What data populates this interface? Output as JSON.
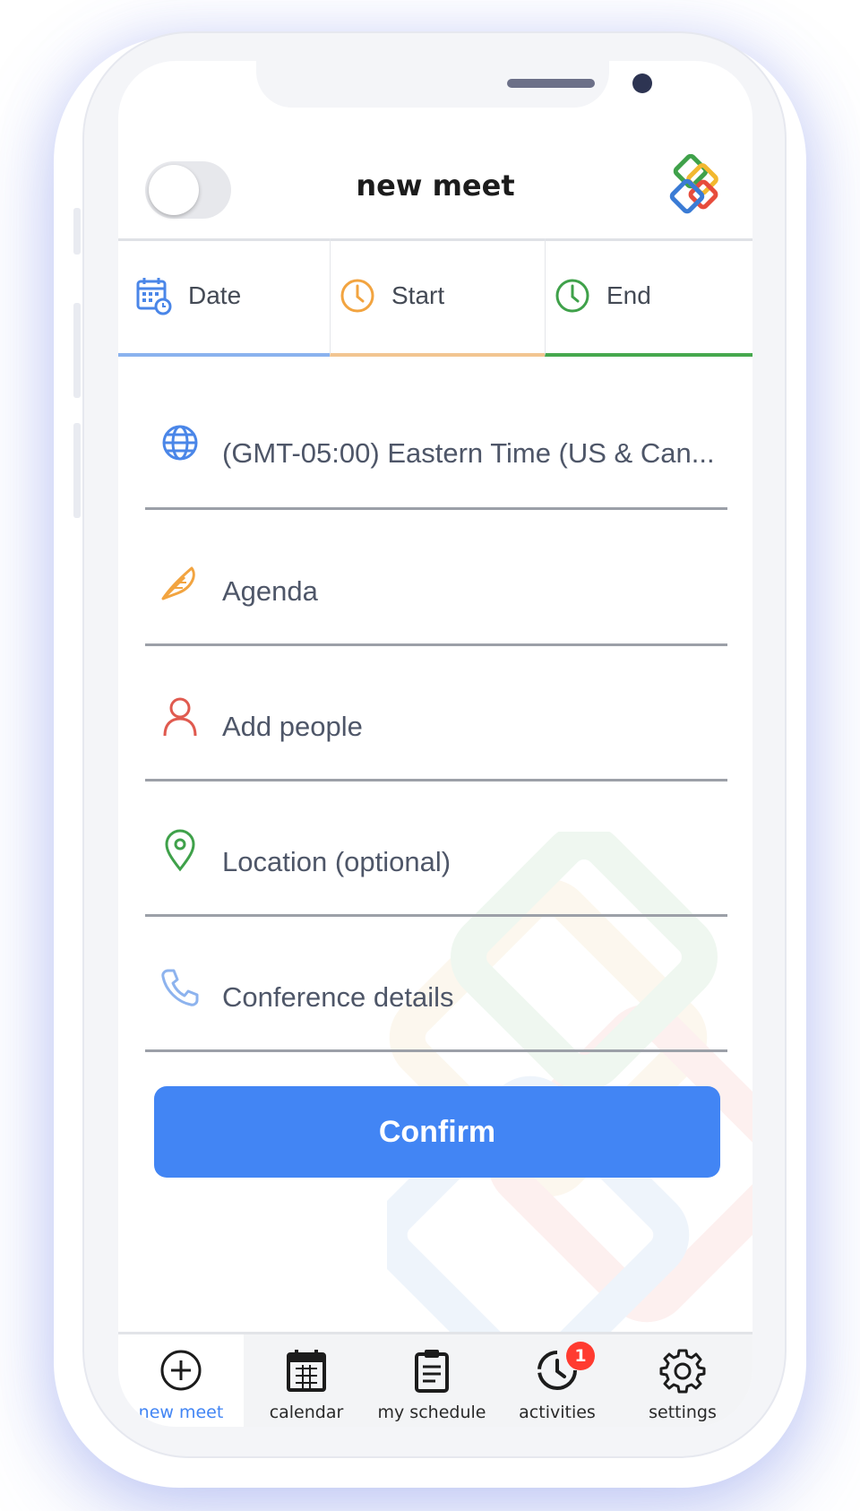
{
  "app": {
    "title": "new meet",
    "colors": {
      "accent": "#4285f4",
      "date_tab": "#8ab2ee",
      "start_tab": "#f2c591",
      "end_tab": "#46a84e",
      "badge": "#ff3b30"
    }
  },
  "header": {
    "toggle_state": "off",
    "logo_icon": "app-logo-icon"
  },
  "tabs": [
    {
      "label": "Date",
      "icon": "calendar-clock-icon"
    },
    {
      "label": "Start",
      "icon": "clock-icon"
    },
    {
      "label": "End",
      "icon": "clock-icon"
    }
  ],
  "form": {
    "timezone": {
      "value": "(GMT-05:00) Eastern Time (US & Can...",
      "icon": "globe-icon"
    },
    "agenda": {
      "placeholder": "Agenda",
      "icon": "feather-icon"
    },
    "people": {
      "placeholder": "Add people",
      "icon": "person-icon"
    },
    "location": {
      "placeholder": "Location (optional)",
      "icon": "location-pin-icon"
    },
    "conference": {
      "placeholder": "Conference details",
      "icon": "phone-icon"
    },
    "confirm_label": "Confirm"
  },
  "bottom_nav": {
    "items": [
      {
        "label": "new meet",
        "icon": "plus-circle-icon",
        "active": true
      },
      {
        "label": "calendar",
        "icon": "calendar-icon"
      },
      {
        "label": "my schedule",
        "icon": "clipboard-icon"
      },
      {
        "label": "activities",
        "icon": "clock-history-icon",
        "badge": "1"
      },
      {
        "label": "settings",
        "icon": "gear-icon"
      }
    ]
  }
}
